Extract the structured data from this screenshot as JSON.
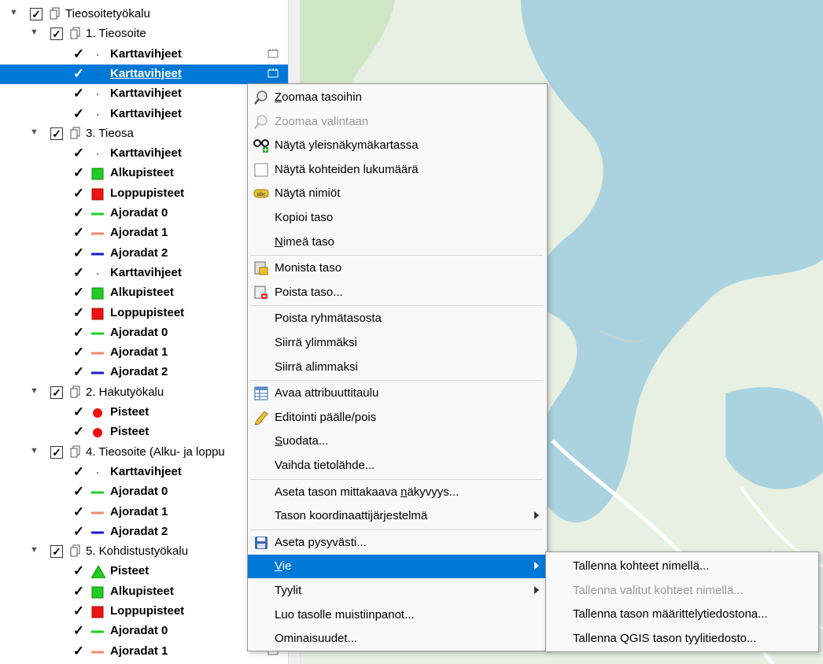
{
  "layer_tree": {
    "rows": [
      {
        "type": "group",
        "depth": 0,
        "label": "Tieosoitetyökalu"
      },
      {
        "type": "group",
        "depth": 1,
        "label": "1. Tieosoite"
      },
      {
        "type": "layer",
        "label": "Karttavihjeet",
        "symbol": "dot",
        "edit": true
      },
      {
        "type": "layer",
        "label": "Karttavihjeet",
        "symbol": "dot",
        "edit": true,
        "selected": true
      },
      {
        "type": "layer",
        "label": "Karttavihjeet",
        "symbol": "dot"
      },
      {
        "type": "layer",
        "label": "Karttavihjeet",
        "symbol": "dot"
      },
      {
        "type": "group",
        "depth": 1,
        "label": "3. Tieosa"
      },
      {
        "type": "layer",
        "label": "Karttavihjeet",
        "symbol": "dot"
      },
      {
        "type": "layer",
        "label": "Alkupisteet",
        "symbol": "green-square"
      },
      {
        "type": "layer",
        "label": "Loppupisteet",
        "symbol": "red-square"
      },
      {
        "type": "layer",
        "label": "Ajoradat 0",
        "symbol": "green-line"
      },
      {
        "type": "layer",
        "label": "Ajoradat 1",
        "symbol": "orange-line"
      },
      {
        "type": "layer",
        "label": "Ajoradat 2",
        "symbol": "blue-line"
      },
      {
        "type": "layer",
        "label": "Karttavihjeet",
        "symbol": "dot"
      },
      {
        "type": "layer",
        "label": "Alkupisteet",
        "symbol": "green-square"
      },
      {
        "type": "layer",
        "label": "Loppupisteet",
        "symbol": "red-square"
      },
      {
        "type": "layer",
        "label": "Ajoradat 0",
        "symbol": "green-line"
      },
      {
        "type": "layer",
        "label": "Ajoradat 1",
        "symbol": "orange-line"
      },
      {
        "type": "layer",
        "label": "Ajoradat 2",
        "symbol": "blue-line"
      },
      {
        "type": "group",
        "depth": 1,
        "label": "2. Hakutyökalu"
      },
      {
        "type": "layer",
        "label": "Pisteet",
        "symbol": "red-circle"
      },
      {
        "type": "layer",
        "label": "Pisteet",
        "symbol": "red-circle"
      },
      {
        "type": "group",
        "depth": 1,
        "label": "4. Tieosoite (Alku- ja loppu"
      },
      {
        "type": "layer",
        "label": "Karttavihjeet",
        "symbol": "dot"
      },
      {
        "type": "layer",
        "label": "Ajoradat 0",
        "symbol": "green-line"
      },
      {
        "type": "layer",
        "label": "Ajoradat 1",
        "symbol": "orange-line"
      },
      {
        "type": "layer",
        "label": "Ajoradat 2",
        "symbol": "blue-line"
      },
      {
        "type": "group",
        "depth": 1,
        "label": "5. Kohdistustyökalu"
      },
      {
        "type": "layer",
        "label": "Pisteet",
        "symbol": "green-triangle"
      },
      {
        "type": "layer",
        "label": "Alkupisteet",
        "symbol": "green-square"
      },
      {
        "type": "layer",
        "label": "Loppupisteet",
        "symbol": "red-square"
      },
      {
        "type": "layer",
        "label": "Ajoradat 0",
        "symbol": "green-line"
      },
      {
        "type": "layer",
        "label": "Ajoradat 1",
        "symbol": "orange-line",
        "edit": true
      }
    ],
    "check_glyph": "✓",
    "expand_glyph": "▼"
  },
  "context_menu": {
    "items": [
      {
        "label": "Zoomaa tasoihin",
        "mnemonic": "Z",
        "icon": "zoom-icon"
      },
      {
        "label": "Zoomaa valintaan",
        "icon": "zoom-selection-icon",
        "disabled": true
      },
      {
        "label": "Näytä yleisnäkymäkartassa",
        "icon": "overview-glasses-icon"
      },
      {
        "label": "Näytä kohteiden lukumäärä",
        "icon": "checkbox-icon"
      },
      {
        "label": "Näytä nimiöt",
        "icon": "labels-abc-icon"
      },
      {
        "label": "Kopioi taso"
      },
      {
        "label": "Nimeä taso",
        "mnemonic": "N",
        "sep_after": true
      },
      {
        "label": "Monista taso",
        "icon": "duplicate-layer-icon"
      },
      {
        "label": "Poista taso...",
        "icon": "remove-layer-icon",
        "sep_after": true
      },
      {
        "label": "Poista ryhmätasosta"
      },
      {
        "label": "Siirrä ylimmäksi"
      },
      {
        "label": "Siirrä alimmaksi",
        "sep_after": true
      },
      {
        "label": "Avaa attribuuttitaulu",
        "icon": "attribute-table-icon"
      },
      {
        "label": "Editointi päälle/pois",
        "icon": "pencil-icon"
      },
      {
        "label": "Suodata...",
        "mnemonic": "S"
      },
      {
        "label": "Vaihda tietolähde...",
        "sep_after": true
      },
      {
        "label": "Aseta tason mittakaava näkyvyys...",
        "mnemonic_word": "näkyvyys"
      },
      {
        "label": "Tason koordinaattijärjestelmä",
        "submenu": true,
        "sep_after": true
      },
      {
        "label": "Aseta pysyvästi...",
        "icon": "save-icon"
      },
      {
        "label": "Vie",
        "mnemonic": "V",
        "submenu": true,
        "highlight": true
      },
      {
        "label": "Tyylit",
        "submenu": true
      },
      {
        "label": "Luo tasolle muistiinpanot..."
      },
      {
        "label": "Ominaisuudet..."
      }
    ]
  },
  "export_submenu": {
    "items": [
      {
        "label": "Tallenna kohteet nimellä..."
      },
      {
        "label": "Tallenna valitut kohteet nimellä...",
        "disabled": true
      },
      {
        "label": "Tallenna tason määrittelytiedostona..."
      },
      {
        "label": "Tallenna QGIS tason tyylitiedosto..."
      }
    ]
  },
  "colors": {
    "selection": "#0078d7",
    "map_land": "#e8efe3",
    "map_water": "#aad3df",
    "green": "#22cc22",
    "red": "#ee1111",
    "orange": "#f08a6a",
    "blue": "#1a1acc"
  }
}
